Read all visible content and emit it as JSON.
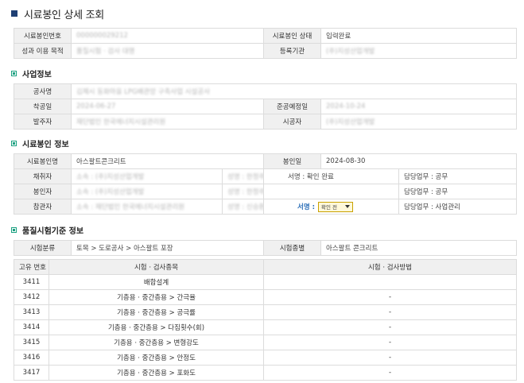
{
  "page": {
    "title": "시료봉인 상세 조회"
  },
  "header_table": {
    "seal_no_label": "시료봉인번호",
    "seal_no": "000000029212",
    "status_label": "시료봉인 상태",
    "status": "입력완료",
    "purpose_label": "성과 이용 목적",
    "purpose": "품질시험 · 검사 대행",
    "agency_label": "등록기관",
    "agency": "(주)지성산업개발"
  },
  "project_section": {
    "title": "사업정보",
    "name_label": "공사명",
    "name": "김제시 동화마을 LPG배관망 구축사업 시설공사",
    "start_label": "착공일",
    "start": "2024-06-27",
    "end_label": "준공예정일",
    "end": "2024-10-24",
    "client_label": "발주자",
    "client": "재단법인 한국에너지시설관리원",
    "contractor_label": "시공자",
    "contractor": "(주)지성산업개발"
  },
  "seal_section": {
    "title": "시료봉인 정보",
    "seal_name_label": "시료봉인명",
    "seal_name": "아스팔트콘크리트",
    "seal_date_label": "봉인일",
    "seal_date": "2024-08-30",
    "collector_label": "채취자",
    "collector_org": "소속 : (주)지성산업개발",
    "collector_person": "성명 : 한정주",
    "collector_sign": "서명 : 확인 완료",
    "collector_duty": "담당업무 : 공무",
    "sealer_label": "봉인자",
    "sealer_org": "소속 : (주)지성산업개발",
    "sealer_person": "성명 : 한정주",
    "sealer_duty": "담당업무 : 공무",
    "witness_label": "참관자",
    "witness_org": "소속 : 재단법인 한국에너지시설관리원",
    "witness_person": "성명 : 신승환",
    "witness_sign_label": "서명 :",
    "witness_sign_select": "확인 전",
    "witness_duty": "담당업무 : 사업관리"
  },
  "quality_section": {
    "title": "품질시험기준 정보",
    "class_label": "시험분류",
    "class_value": "토목 > 도로공사 > 아스팔트 포장",
    "kind_label": "시험종별",
    "kind_value": "아스팔트 콘크리트",
    "columns": [
      "고유 번호",
      "시험 · 검사종목",
      "시험 · 검사방법"
    ],
    "rows": [
      {
        "id": "3411",
        "item": "배합설계",
        "method": ""
      },
      {
        "id": "3412",
        "item": "기층용 · 중간층용 > 간극율",
        "method": "-"
      },
      {
        "id": "3413",
        "item": "기층용 · 중간층용 > 공극률",
        "method": "-"
      },
      {
        "id": "3414",
        "item": "기층용 · 중간층용 > 다짐횟수(회)",
        "method": "-"
      },
      {
        "id": "3415",
        "item": "기층용 · 중간층용 > 변형강도",
        "method": "-"
      },
      {
        "id": "3416",
        "item": "기층용 · 중간층용 > 안정도",
        "method": "-"
      },
      {
        "id": "3417",
        "item": "기층용 · 중간층용 > 포화도",
        "method": "-"
      }
    ]
  },
  "colors": {
    "title_square": "#1e3f73",
    "section_square": "#1aa080",
    "label_bg": "#f0f0f0",
    "select_border": "#c9a100",
    "sign_label": "#2c6fb8"
  },
  "icons": {
    "title": "square-bullet-icon",
    "section": "square-bullet-icon",
    "select": "dropdown-caret-icon"
  }
}
